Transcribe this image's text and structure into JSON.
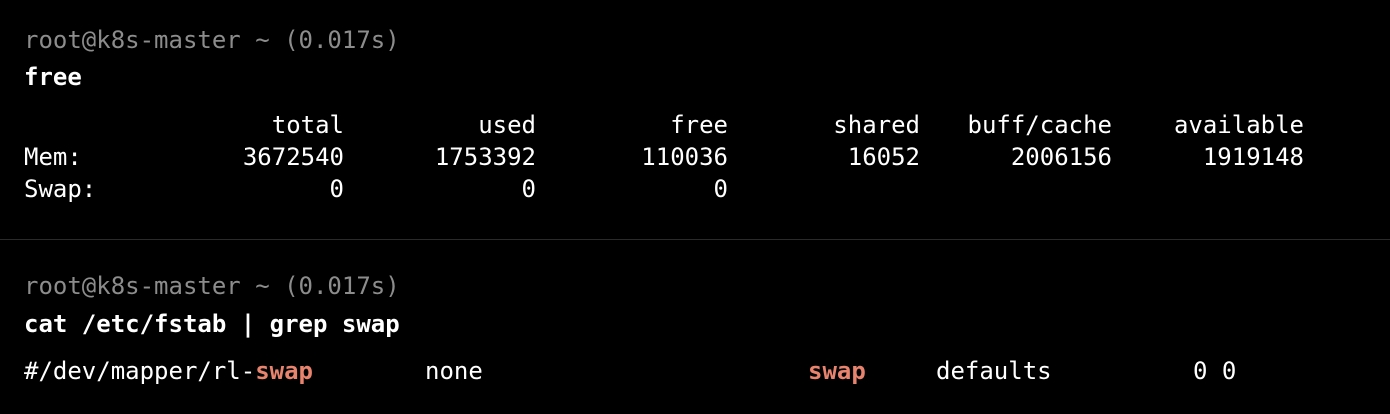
{
  "blocks": [
    {
      "prompt": "root@k8s-master ~ (0.017s)",
      "command": "free",
      "output": {
        "headers": [
          "total",
          "used",
          "free",
          "shared",
          "buff/cache",
          "available"
        ],
        "rows": [
          {
            "label": "Mem:",
            "values": [
              "3672540",
              "1753392",
              "110036",
              "16052",
              "2006156",
              "1919148"
            ]
          },
          {
            "label": "Swap:",
            "values": [
              "0",
              "0",
              "0"
            ]
          }
        ]
      }
    },
    {
      "prompt": "root@k8s-master ~ (0.017s)",
      "command": "cat /etc/fstab | grep swap",
      "output": {
        "device_prefix": "#/dev/mapper/rl-",
        "device_match": "swap",
        "mount": "none",
        "type": "swap",
        "options": "defaults",
        "dump_pass": "0 0"
      }
    }
  ],
  "colors": {
    "background": "#000000",
    "prompt": "#8c8c8c",
    "text": "#ffffff",
    "match_highlight": "#e8836e"
  }
}
